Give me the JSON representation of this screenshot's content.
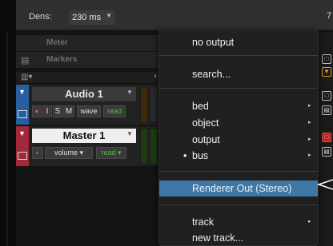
{
  "toolbar": {
    "dens_label": "Dens:",
    "dens_value": "230 ms",
    "right_fragment": "7"
  },
  "header_rows": [
    {
      "label": "Meter"
    },
    {
      "label": "Markers"
    }
  ],
  "tracks": [
    {
      "name": "Audio 1",
      "buttons": [
        "●",
        "I",
        "S",
        "M",
        "wave",
        "read"
      ]
    },
    {
      "name": "Master 1",
      "buttons": [
        "volume",
        "read"
      ]
    }
  ],
  "menu": {
    "items": [
      {
        "label": "no output"
      },
      {
        "label": "search..."
      },
      {
        "label": "bed"
      },
      {
        "label": "object"
      },
      {
        "label": "output"
      },
      {
        "label": "bus",
        "bullet": "•"
      },
      {
        "label": "Renderer Out (Stereo)"
      },
      {
        "label": "track"
      },
      {
        "label": "new track..."
      }
    ]
  },
  "colors": {
    "audio_track": "#28609f",
    "master_track": "#a3283a",
    "highlight": "#3f77a6",
    "read_green": "#55b84a"
  },
  "icons": {
    "dropdown": "chevron-down-icon",
    "submenu": "chevron-right-icon",
    "collapse": "triangle-down-icon"
  }
}
